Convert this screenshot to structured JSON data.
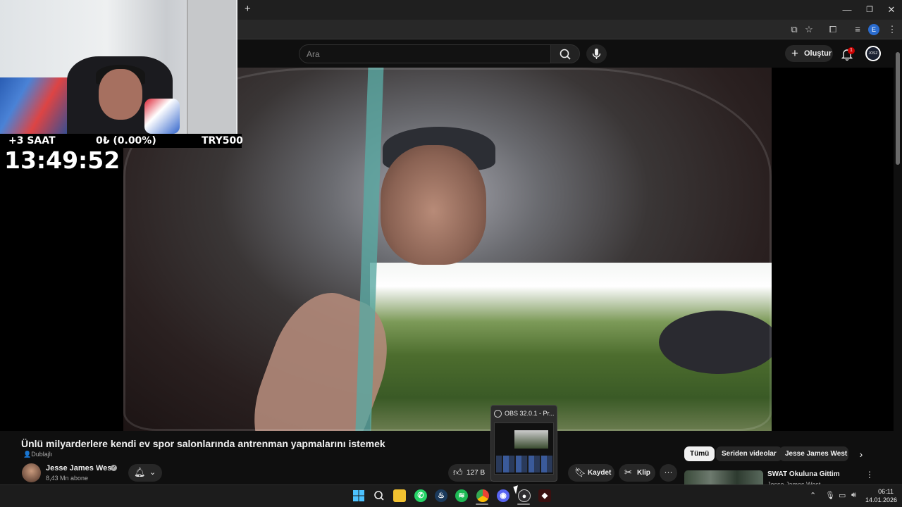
{
  "browser": {
    "new_tab": "+",
    "window_controls": {
      "minimize": "—",
      "restore": "❐",
      "close": "✕"
    },
    "toolbar_icons": [
      "cast-icon",
      "star-icon",
      "extensions-icon",
      "tab-search-icon",
      "profile-icon",
      "menu-icon"
    ],
    "profile_letter": "E"
  },
  "youtube": {
    "search_placeholder": "Ara",
    "create_label": "Oluştur",
    "notification_count": "1",
    "avatar_text": "JOSZ"
  },
  "stream_overlay": {
    "hours_added": "+3 SAAT",
    "donation_amount": "0₺ (0.00%)",
    "goal": "TRY500",
    "timer": "13:49:52"
  },
  "video": {
    "title": "Ünlü milyarderlere kendi ev spor salonlarında antrenman yapmalarını istemek",
    "dubbed_label": "Dublajlı",
    "channel_name": "Jesse James West",
    "subscribers": "8,43 Mn abone",
    "like_count": "127 B",
    "save_label": "Kaydet",
    "clip_label": "Klip",
    "more_label": "···"
  },
  "chips": [
    "Tümü",
    "Seriden videolar",
    "Jesse James West ac"
  ],
  "recommended": {
    "title": "SWAT Okuluna Gittim",
    "channel": "Jesse James West"
  },
  "obs_popup": {
    "title": "OBS 32.0.1 - Pr..."
  },
  "taskbar": {
    "apps": [
      "windows-start",
      "search",
      "file-explorer",
      "whatsapp",
      "steam",
      "spotify",
      "chrome",
      "discord",
      "obs",
      "app"
    ],
    "time": "06:11",
    "date": "14.01.2026"
  }
}
